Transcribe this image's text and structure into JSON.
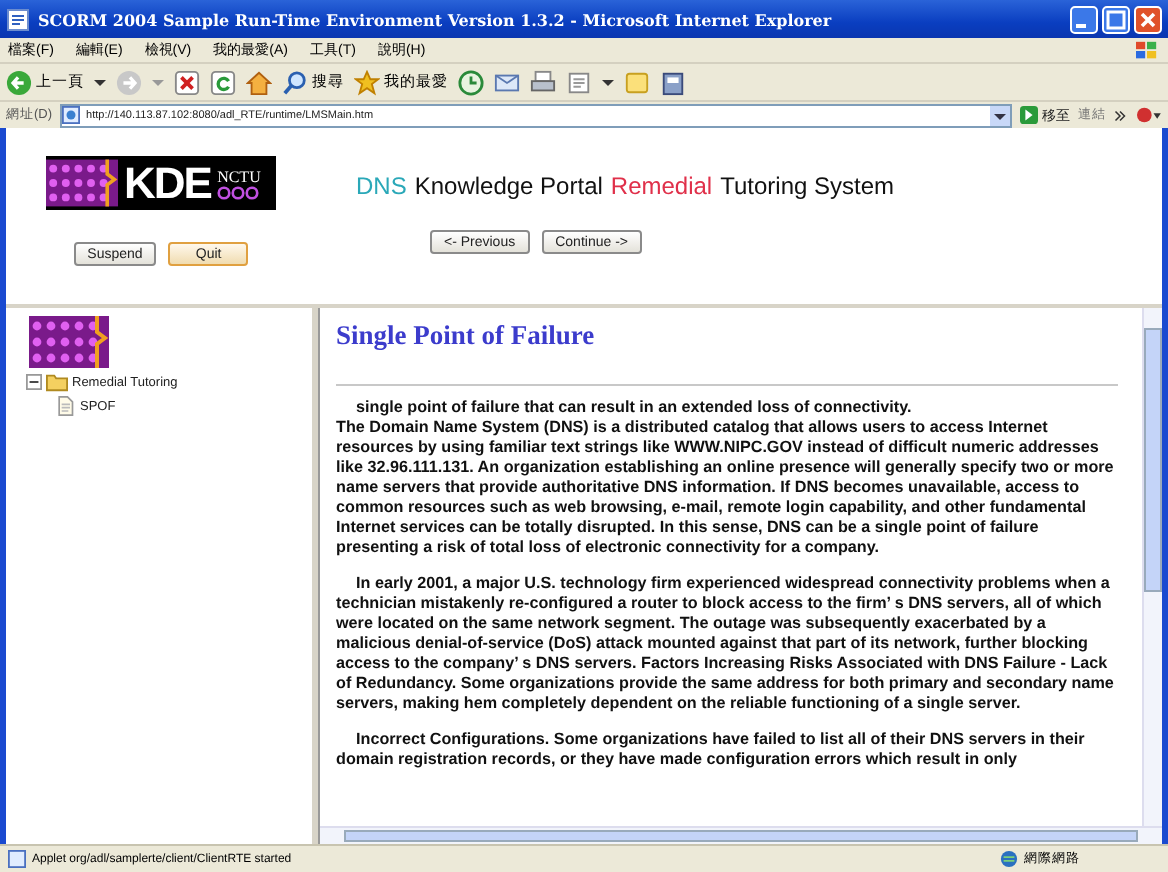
{
  "window": {
    "title": "SCORM 2004 Sample Run-Time Environment Version 1.3.2 - Microsoft Internet Explorer"
  },
  "menu": [
    "檔案(F)",
    "編輯(E)",
    "檢視(V)",
    "我的最愛(A)",
    "工具(T)",
    "說明(H)"
  ],
  "toolbar": {
    "back_label": "上一頁",
    "search_label": "搜尋",
    "favorites_label": "我的最愛"
  },
  "address_bar": {
    "label": "網址(D)",
    "url": "http://140.113.87.102:8080/adl_RTE/runtime/LMSMain.htm",
    "go_label": "移至",
    "links_label": "連結"
  },
  "header": {
    "logo": {
      "text": "KDE",
      "subtext": "NCTU"
    },
    "title": [
      {
        "text": "DNS",
        "color": "#2aa8b8"
      },
      {
        "text": "Knowledge Portal",
        "color": "#111111"
      },
      {
        "text": "Remedial",
        "color": "#e0304a"
      },
      {
        "text": "Tutoring System",
        "color": "#111111"
      }
    ],
    "buttons": [
      {
        "label": "Suspend",
        "focused": false
      },
      {
        "label": "Quit",
        "focused": true
      }
    ],
    "nav_buttons": [
      "<- Previous",
      "Continue ->"
    ]
  },
  "tree": {
    "label": "Remedial Tutoring",
    "expanded": true,
    "children": [
      {
        "label": "SPOF"
      }
    ]
  },
  "content": {
    "heading": "Single Point of Failure",
    "paragraphs": [
      {
        "text": "single point of failure that can result in an extended loss of connectivity.",
        "indent": true,
        "space_after": false
      },
      {
        "text": "The Domain Name System (DNS) is a distributed catalog that allows users to access Internet resources by using familiar text strings like WWW.NIPC.GOV instead of difficult numeric addresses like 32.96.111.131. An organization establishing an online presence will generally specify two or more name servers that provide authoritative DNS information. If DNS becomes unavailable, access to common resources such as web browsing, e-mail, remote login capability, and other fundamental Internet services can be totally disrupted. In this sense, DNS can be a single point of failure presenting a risk of total loss of electronic connectivity for a company.",
        "indent": false,
        "space_after": true
      },
      {
        "text": "In early 2001, a major U.S. technology firm experienced widespread connectivity problems when a technician mistakenly re-configured a router to block access to the firm’ s DNS servers, all of which were located on the same network segment. The outage was subsequently exacerbated by a malicious denial-of-service (DoS) attack mounted against that part of its network, further blocking access to the company’ s DNS servers. Factors Increasing Risks Associated with DNS Failure - Lack of Redundancy. Some organizations provide the same address for both primary and secondary name servers, making hem completely dependent on the reliable functioning of a single server.",
        "indent": true,
        "space_after": true
      },
      {
        "text": "Incorrect Configurations. Some organizations have failed to list all of their DNS servers in their domain registration records, or they have made configuration errors which result in only",
        "indent": true,
        "space_after": false
      }
    ]
  },
  "status_bar": {
    "text": "Applet org/adl/samplerte/client/ClientRTE started",
    "zone": "網際網路"
  }
}
